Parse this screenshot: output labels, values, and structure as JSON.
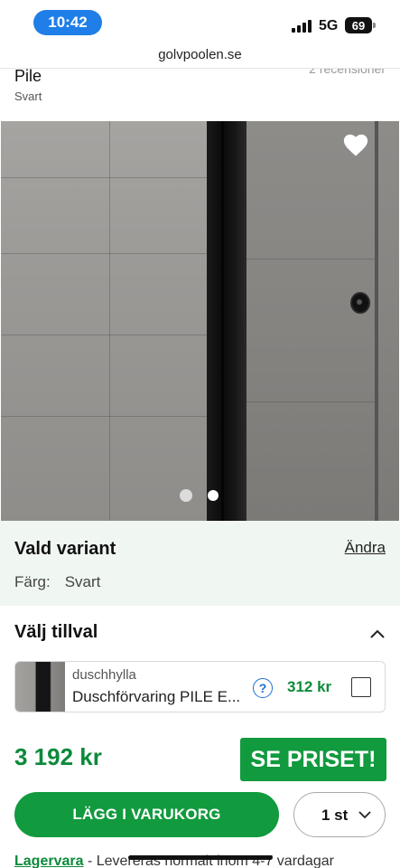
{
  "status_bar": {
    "time": "10:42",
    "network": "5G",
    "battery": "69"
  },
  "browser": {
    "url": "golvpoolen.se"
  },
  "product": {
    "name": "Pile",
    "color": "Svart",
    "reviews": "2 recensioner"
  },
  "gallery": {
    "total_images": 2,
    "active_index": 1
  },
  "variant": {
    "title": "Vald variant",
    "change_label": "Ändra",
    "color_label": "Färg:",
    "color_value": "Svart"
  },
  "addons": {
    "title": "Välj tillval",
    "items": [
      {
        "category": "duschhylla",
        "name": "Duschförvaring PILE E...",
        "price": "312 kr",
        "help": "?",
        "checked": false
      }
    ]
  },
  "pricing": {
    "price": "3 192 kr",
    "see_price_label": "SE PRISET!"
  },
  "cart": {
    "add_label": "LÄGG I VARUKORG",
    "quantity": "1 st"
  },
  "stock": {
    "label": "Lagervara",
    "text": " - Levereras normalt inom 4-7 vardagar"
  },
  "colors": {
    "brand_green": "#119a3e",
    "price_green": "#0c8a3a",
    "variant_bg": "#f0f7f2",
    "time_pill": "#1f7ee8"
  }
}
